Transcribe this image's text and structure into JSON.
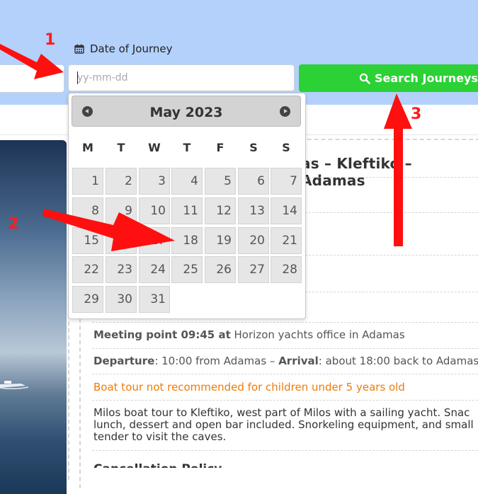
{
  "form": {
    "date_label": "Date of Journey",
    "date_placeholder": "yy-mm-dd",
    "search_label": "Search Journeys"
  },
  "calendar": {
    "title": "May 2023",
    "weekdays": [
      "M",
      "T",
      "W",
      "T",
      "F",
      "S",
      "S"
    ],
    "days": [
      "1",
      "2",
      "3",
      "4",
      "5",
      "6",
      "7",
      "8",
      "9",
      "10",
      "11",
      "12",
      "13",
      "14",
      "15",
      "16",
      "17",
      "18",
      "19",
      "20",
      "21",
      "22",
      "23",
      "24",
      "25",
      "26",
      "27",
      "28",
      "29",
      "30",
      "31"
    ]
  },
  "tour": {
    "title_visible": "as – Kleftiko – Adamas",
    "meeting_prefix": "Meeting point 09:45 at",
    "meeting_text": "Horizon yachts office in Adamas",
    "departure_label": "Departure",
    "departure_text": ": 10:00 from Adamas –",
    "arrival_label": "Arrival",
    "arrival_text": ": about 18:00 back to Adamas",
    "warning": "Boat tour not recommended for children under 5 years old",
    "desc_line1": "Milos boat tour to Kleftiko, west part of Milos with a sailing yacht. Snac",
    "desc_line2": "lunch, dessert and open bar included. Snorkeling equipment, and small",
    "desc_line3": "tender to visit the caves.",
    "cutoff_heading": "Cancellation Policy"
  },
  "annotations": {
    "n1": "1",
    "n2": "2",
    "n3": "3"
  },
  "colors": {
    "accent": "#2bd135",
    "header_bg": "#b3d1fb",
    "annotation": "#ff1d1d",
    "warning": "#f07b05"
  }
}
